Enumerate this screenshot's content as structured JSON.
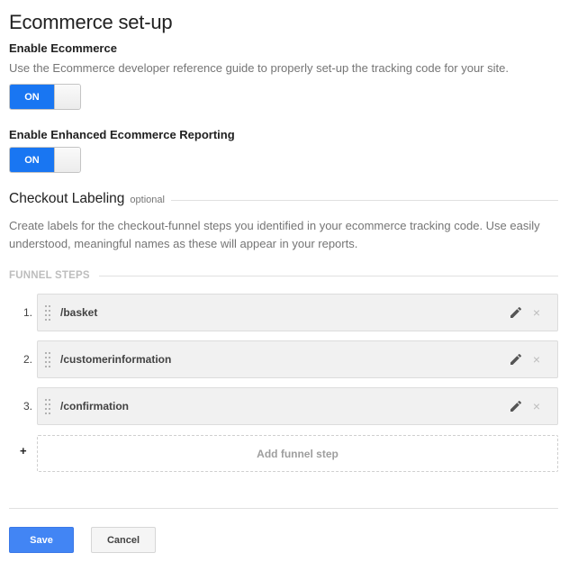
{
  "page": {
    "title": "Ecommerce set-up"
  },
  "enable_ecommerce": {
    "label": "Enable Ecommerce",
    "help": "Use the Ecommerce developer reference guide to properly set-up the tracking code for your site.",
    "toggle_label": "ON",
    "state": "on"
  },
  "enhanced_reporting": {
    "label": "Enable Enhanced Ecommerce Reporting",
    "toggle_label": "ON",
    "state": "on"
  },
  "checkout_labeling": {
    "heading": "Checkout Labeling",
    "optional": "optional",
    "help": "Create labels for the checkout-funnel steps you identified in your ecommerce tracking code. Use easily understood, meaningful names as these will appear in your reports."
  },
  "funnel": {
    "title": "FUNNEL STEPS",
    "steps": [
      {
        "number": "1.",
        "label": "/basket"
      },
      {
        "number": "2.",
        "label": "/customerinformation"
      },
      {
        "number": "3.",
        "label": "/confirmation"
      }
    ],
    "add_plus": "+",
    "add_label": "Add funnel step",
    "icons": {
      "drag": "drag-handle-icon",
      "edit": "pencil-icon",
      "remove": "close-icon",
      "remove_glyph": "×"
    }
  },
  "actions": {
    "save_label": "Save",
    "cancel_label": "Cancel"
  },
  "colors": {
    "toggle_on": "#1976f2",
    "save_button": "#4285f4",
    "muted_text": "#757575"
  }
}
